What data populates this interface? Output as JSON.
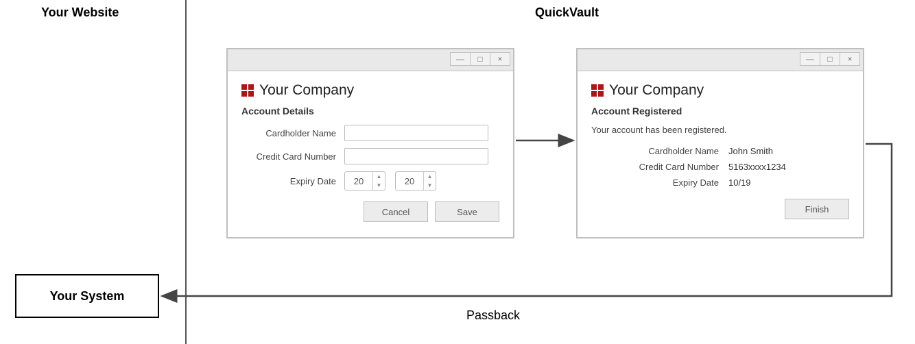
{
  "regions": {
    "your_website": "Your Website",
    "quickvault": "QuickVault"
  },
  "company_name": "Your Company",
  "window1": {
    "heading": "Account Details",
    "labels": {
      "cardholder": "Cardholder Name",
      "cardnumber": "Credit Card Number",
      "expiry": "Expiry Date"
    },
    "expiry_values": {
      "a": "20",
      "b": "20"
    },
    "buttons": {
      "cancel": "Cancel",
      "save": "Save"
    }
  },
  "window2": {
    "heading": "Account Registered",
    "message": "Your account has been registered.",
    "fields": {
      "cardholder_label": "Cardholder Name",
      "cardholder_value": "John Smith",
      "cardnumber_label": "Credit Card Number",
      "cardnumber_value": "5163xxxx1234",
      "expiry_label": "Expiry Date",
      "expiry_value": "10/19"
    },
    "buttons": {
      "finish": "Finish"
    }
  },
  "system_box": "Your System",
  "passback": "Passback",
  "win_controls": {
    "min": "—",
    "max": "□",
    "close": "×"
  }
}
